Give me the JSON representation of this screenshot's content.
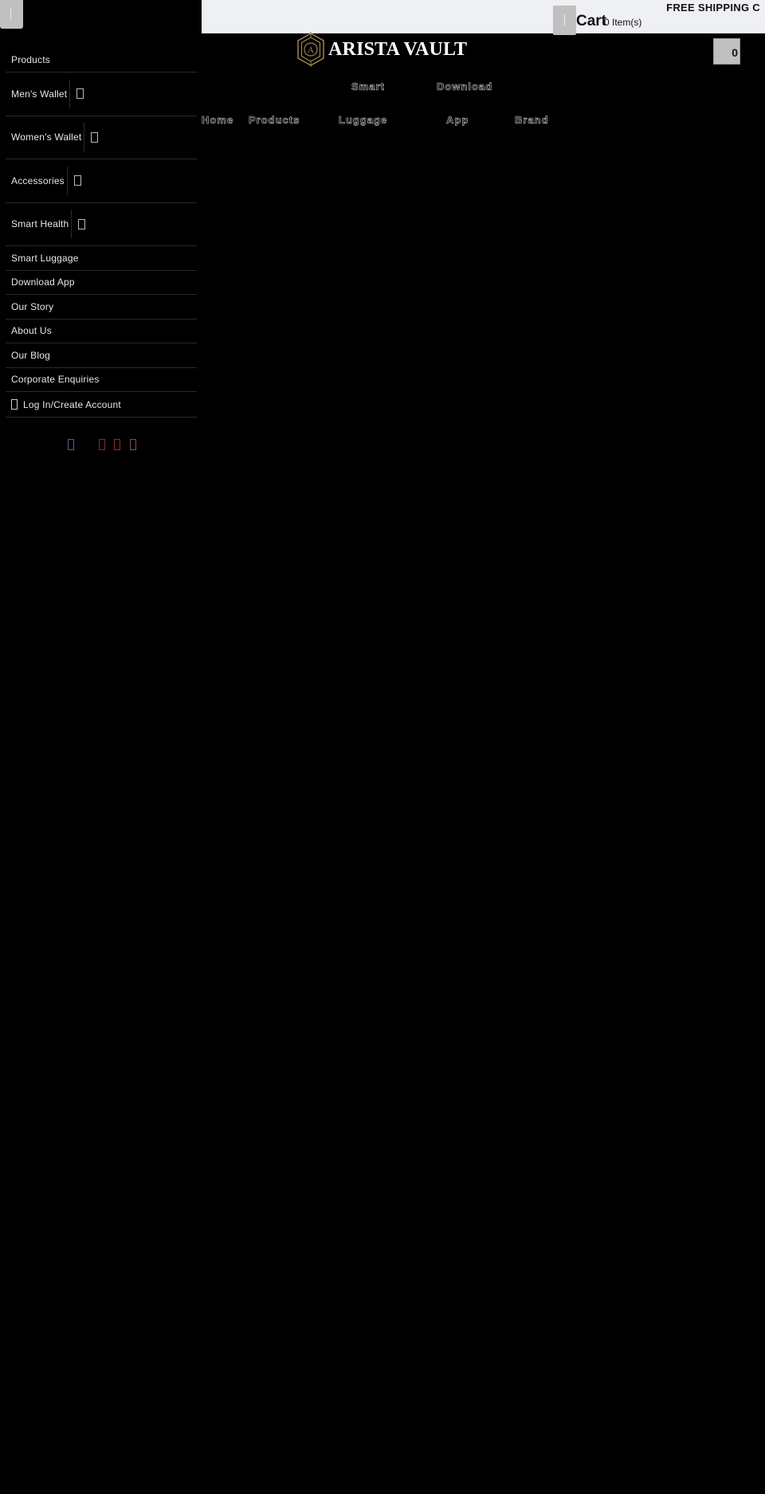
{
  "announcement": {
    "text": "FREE SHIPPING C"
  },
  "cart": {
    "title": "Cart",
    "items_label": "0 Item(s)",
    "badge_count": "0"
  },
  "brand": {
    "name": "ARISTA VAULT",
    "logo_letter": "A",
    "logo_color": "#a08353"
  },
  "main_nav": {
    "items": [
      {
        "label": "Home"
      },
      {
        "label": "Products"
      },
      {
        "line1": "Smart",
        "line2": "Luggage"
      },
      {
        "line1": "Download",
        "line2": "App"
      },
      {
        "label": "Brand"
      }
    ]
  },
  "drawer": {
    "menu": [
      {
        "label": "Products",
        "has_submenu": false
      },
      {
        "label": "Men's Wallet",
        "has_submenu": true
      },
      {
        "label": "Women's Wallet",
        "has_submenu": true
      },
      {
        "label": "Accessories",
        "has_submenu": true
      },
      {
        "label": "Smart Health",
        "has_submenu": true
      },
      {
        "label": "Smart Luggage",
        "has_submenu": false
      },
      {
        "label": "Download App",
        "has_submenu": false
      },
      {
        "label": "Our Story",
        "has_submenu": false
      },
      {
        "label": "About Us",
        "has_submenu": false
      },
      {
        "label": "Our Blog",
        "has_submenu": false
      },
      {
        "label": "Corporate Enquiries",
        "has_submenu": false
      }
    ],
    "login_label": "Log In/Create Account",
    "social": [
      {
        "icon": "facebook-icon",
        "color": "#5a5f8c"
      },
      {
        "icon": "youtube-icon",
        "color": "#8b2a2a"
      },
      {
        "icon": "pinterest-icon",
        "color": "#8e2d2d"
      },
      {
        "icon": "instagram-icon",
        "color": "#7a4f5c"
      }
    ]
  }
}
